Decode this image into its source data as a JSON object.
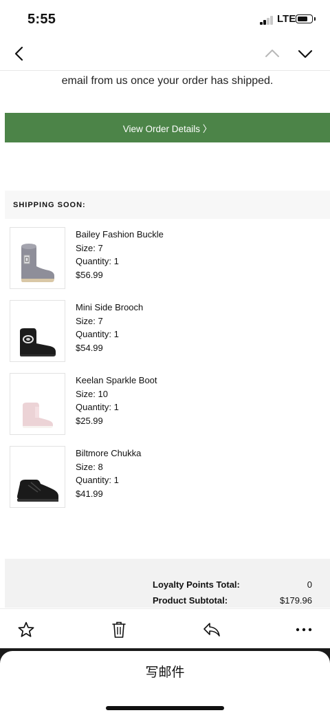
{
  "status_bar": {
    "time": "5:55",
    "network": "LTE"
  },
  "nav": {
    "back_icon": "chevron-left-icon",
    "prev_icon": "chevron-up-icon",
    "next_icon": "chevron-down-icon"
  },
  "email": {
    "intro_line": "email from us once your order has shipped.",
    "cta_label": "View Order Details 〉",
    "cta_color": "#4c8448",
    "shipping_header": "SHIPPING SOON:",
    "items": [
      {
        "name": "Bailey Fashion Buckle",
        "size": "Size: 7",
        "quantity": "Quantity: 1",
        "price": "$56.99"
      },
      {
        "name": "Mini Side Brooch",
        "size": "Size: 7",
        "quantity": "Quantity: 1",
        "price": "$54.99"
      },
      {
        "name": "Keelan Sparkle Boot",
        "size": "Size: 10",
        "quantity": "Quantity: 1",
        "price": "$25.99"
      },
      {
        "name": "Biltmore Chukka",
        "size": "Size: 8",
        "quantity": "Quantity: 1",
        "price": "$41.99"
      }
    ],
    "summary": {
      "loyalty_label": "Loyalty Points Total:",
      "loyalty_value": "0",
      "subtotal_label": "Product Subtotal:",
      "subtotal_value": "$179.96"
    }
  },
  "toolbar": {
    "flag_icon": "star-icon",
    "trash_icon": "trash-icon",
    "reply_icon": "reply-icon",
    "more_icon": "more-icon"
  },
  "compose": {
    "label": "写邮件"
  }
}
